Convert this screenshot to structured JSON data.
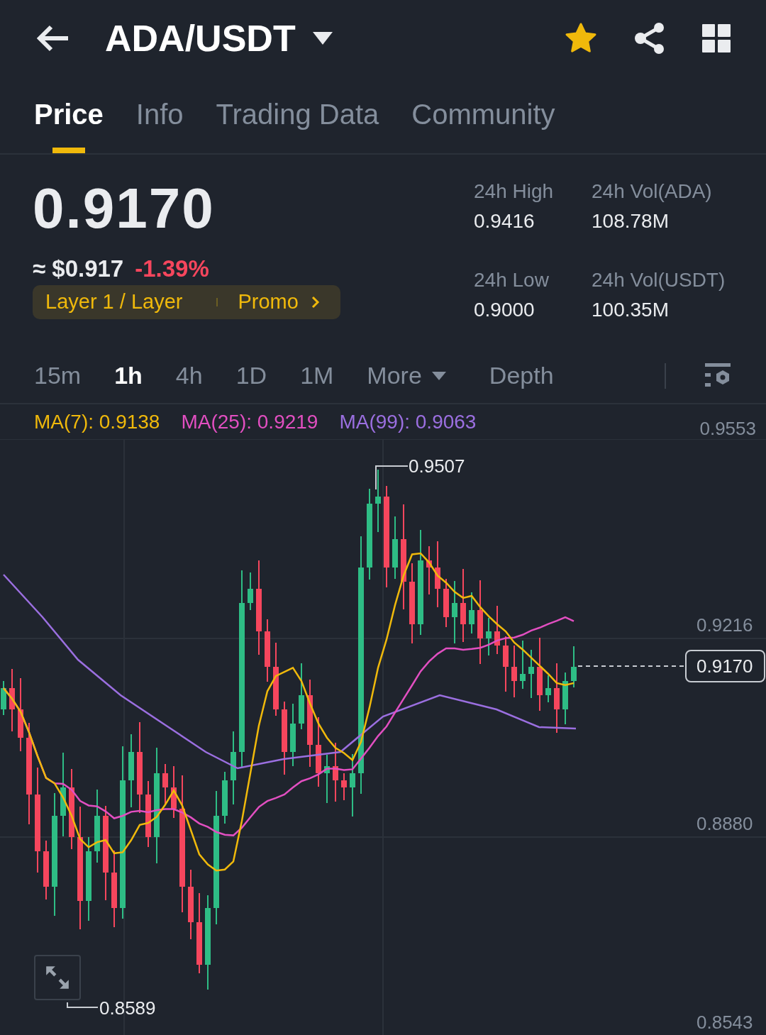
{
  "header": {
    "pair": "ADA/USDT",
    "favorite": true
  },
  "tabs": [
    {
      "label": "Price",
      "selected": true
    },
    {
      "label": "Info",
      "selected": false
    },
    {
      "label": "Trading Data",
      "selected": false
    },
    {
      "label": "Community",
      "selected": false
    }
  ],
  "price": {
    "last": "0.9170",
    "fiat": "≈ $0.917",
    "change": "-1.39%"
  },
  "tag": {
    "label": "Layer 1 / Layer",
    "promo": "Promo"
  },
  "stats": [
    {
      "label": "24h High",
      "value": "0.9416"
    },
    {
      "label": "24h Vol(ADA)",
      "value": "108.78M"
    },
    {
      "label": "24h Low",
      "value": "0.9000"
    },
    {
      "label": "24h Vol(USDT)",
      "value": "100.35M"
    }
  ],
  "intervals": [
    {
      "label": "15m",
      "kind": "interval",
      "selected": false
    },
    {
      "label": "1h",
      "kind": "interval",
      "selected": true
    },
    {
      "label": "4h",
      "kind": "interval",
      "selected": false
    },
    {
      "label": "1D",
      "kind": "interval",
      "selected": false
    },
    {
      "label": "1M",
      "kind": "interval",
      "selected": false
    },
    {
      "label": "More",
      "kind": "dropdown",
      "selected": false
    }
  ],
  "depth_tab": "Depth",
  "chart": {
    "indicators": [
      {
        "label": "MA(7): 0.9138",
        "color": "#f0b90b"
      },
      {
        "label": "MA(25): 0.9219",
        "color": "#e24fc1"
      },
      {
        "label": "MA(99): 0.9063",
        "color": "#9b6fe0"
      }
    ],
    "axis_labels": [
      "0.9553",
      "0.9216",
      "0.8880",
      "0.8543"
    ],
    "high_marker": "0.9507",
    "low_marker": "0.8589",
    "current_price": "0.9170"
  }
}
